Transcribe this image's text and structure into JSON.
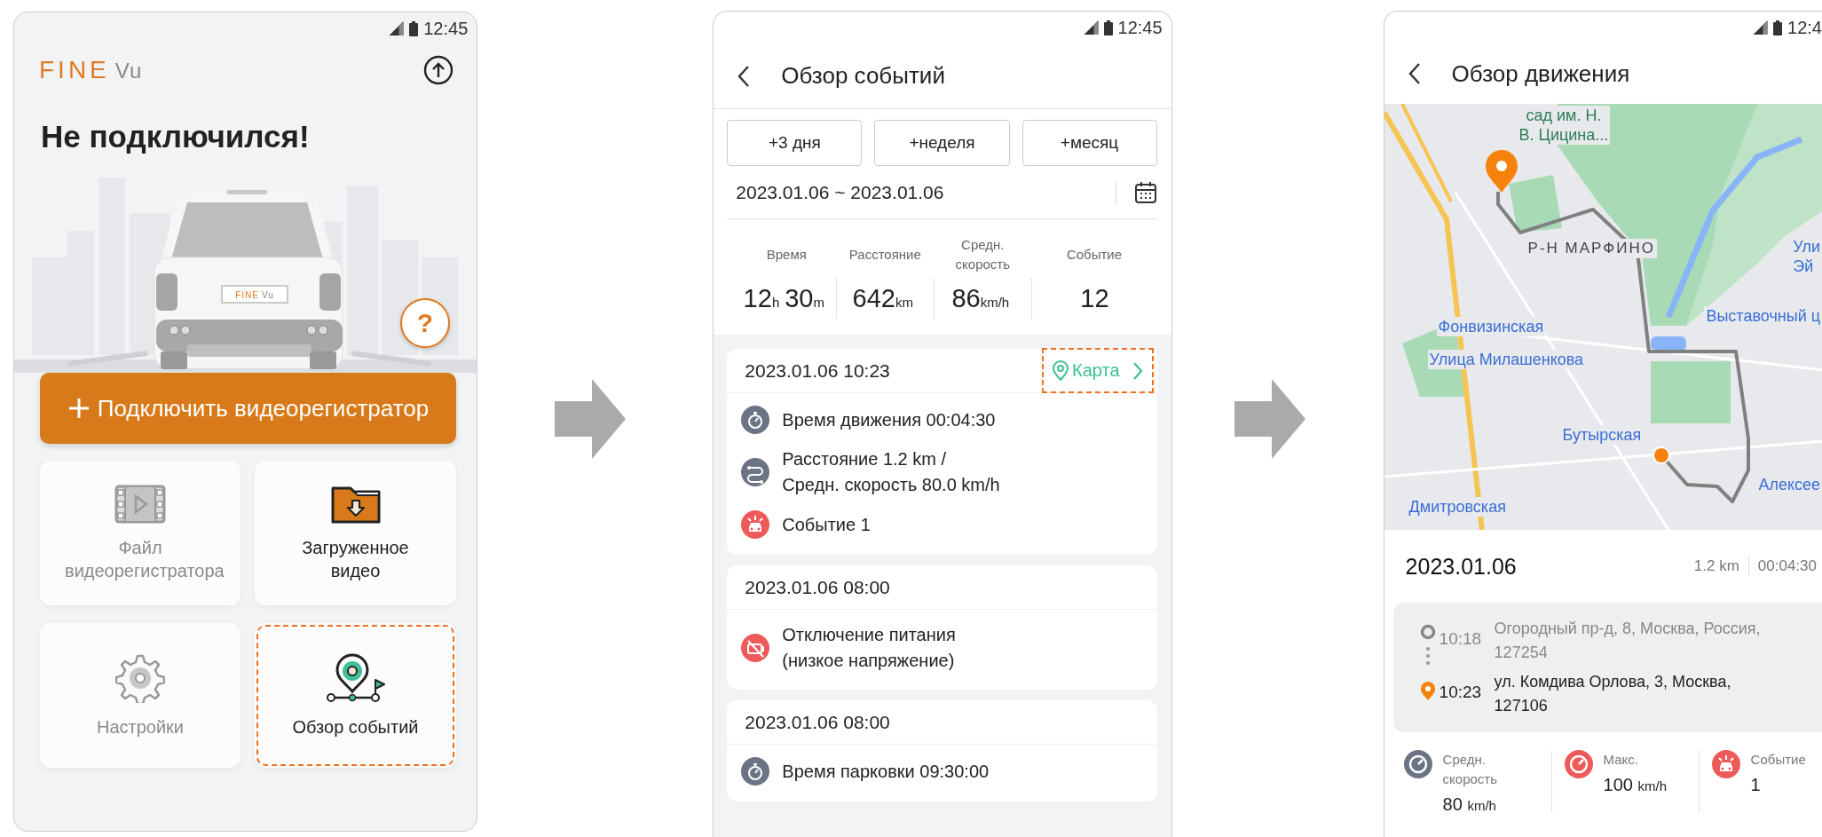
{
  "home_screen": {
    "status_time": "12:45",
    "logo": {
      "brand": "FINE",
      "suffix": "Vu"
    },
    "title": "Не подключился!",
    "car_plate": {
      "brand": "FINE",
      "suffix": "Vu"
    },
    "help_button": "?",
    "connect_button": "Подключить видеорегистратор",
    "tiles": [
      {
        "kind": "film",
        "label": "Файл видеорегистратора",
        "disabled": true,
        "highlighted": false
      },
      {
        "kind": "folder",
        "label": "Загруженное видео",
        "disabled": false,
        "highlighted": false
      },
      {
        "kind": "gear",
        "label": "Настройки",
        "disabled": true,
        "highlighted": false
      },
      {
        "kind": "route",
        "label": "Обзор событий",
        "disabled": false,
        "highlighted": true
      }
    ]
  },
  "events_screen": {
    "status_time": "12:45",
    "title": "Обзор событий",
    "range_buttons": [
      "+3 дня",
      "+неделя",
      "+месяц"
    ],
    "date_range": "2023.01.06 ~ 2023.01.06",
    "stats": [
      {
        "label": "Время",
        "parts": [
          {
            "number": "12",
            "unit": "h"
          },
          {
            "number": "30",
            "unit": "m"
          }
        ]
      },
      {
        "label": "Расстояние",
        "parts": [
          {
            "number": "642",
            "unit": "km"
          }
        ]
      },
      {
        "label": "Средн.\nскорость",
        "parts": [
          {
            "number": "86",
            "unit": "km/h"
          }
        ]
      },
      {
        "label": "Событие",
        "parts": [
          {
            "number": "12"
          }
        ]
      }
    ],
    "events": [
      {
        "datetime": "2023.01.06 10:23",
        "map_link": {
          "label": "Карта",
          "highlighted": true
        },
        "items": [
          {
            "kind": "timer",
            "text": "Время движения 00:04:30"
          },
          {
            "kind": "route",
            "text": "Расстояние 1.2 km /\nСредн. скорость 80.0 km/h"
          },
          {
            "kind": "event",
            "text": "Событие 1"
          }
        ]
      },
      {
        "datetime": "2023.01.06 08:00",
        "items": [
          {
            "kind": "power_off",
            "text": "Отключение питания\n(низкое напряжение)"
          }
        ]
      },
      {
        "datetime": "2023.01.06 08:00",
        "items": [
          {
            "kind": "timer",
            "text": "Время парковки 09:30:00"
          }
        ]
      }
    ]
  },
  "drive_screen": {
    "status_time": "12:4",
    "title": "Обзор движения",
    "map_labels": [
      "сад им. Н.\nВ. Цицина...",
      "Р-Н МАРФИНО",
      "Ули\nЭй",
      "Выставочный ц",
      "Фонвизинская",
      "Улица Милашенкова",
      "Бутырская",
      "Алексее",
      "Дмитровская"
    ],
    "date": "2023.01.06",
    "distance": "1.2 km",
    "duration": "00:04:30",
    "trip": [
      {
        "kind": "start",
        "time": "10:18",
        "address": "Огородный пр-д, 8, Москва, Россия,\n127254"
      },
      {
        "kind": "end",
        "time": "10:23",
        "address": "ул. Комдива Орлова, 3, Москва,\n127106"
      }
    ],
    "stats": [
      {
        "kind": "avg",
        "label": "Средн.\nскорость",
        "value": "80",
        "unit": "km/h"
      },
      {
        "kind": "max",
        "label": "Макс.",
        "value": "100",
        "unit": "km/h"
      },
      {
        "kind": "event",
        "label": "Событие",
        "value": "1"
      }
    ]
  }
}
